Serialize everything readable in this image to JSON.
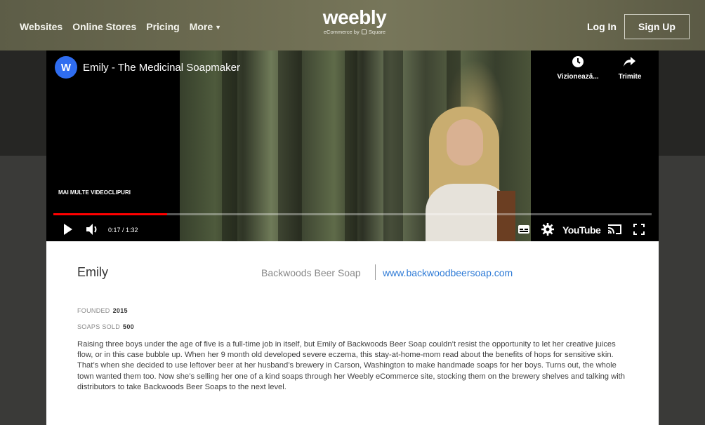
{
  "header": {
    "nav": [
      "Websites",
      "Online Stores",
      "Pricing",
      "More"
    ],
    "brand": "weebly",
    "brand_sub_left": "eCommerce by",
    "brand_sub_right": "Square",
    "login": "Log In",
    "signup": "Sign Up"
  },
  "video": {
    "channel_initial": "W",
    "title": "Emily - The Medicinal Soapmaker",
    "watch_later": "Vizionează...",
    "share": "Trimite",
    "more_videos": "MAI MULTE VIDEOCLIPURI",
    "time": "0:17 / 1:32",
    "progress": 0.19,
    "youtube_label": "YouTube",
    "icons": [
      "clock-icon",
      "share-icon",
      "play-icon",
      "volume-icon",
      "subtitles-icon",
      "settings-icon",
      "cast-icon",
      "fullscreen-icon"
    ],
    "progress_color": "#ff0000"
  },
  "profile": {
    "name": "Emily",
    "company": "Backwoods Beer Soap",
    "website": "www.backwoodbeersoap.com",
    "founded_label": "FOUNDED",
    "founded": "2015",
    "soaps_label": "SOAPS SOLD",
    "soaps": "500",
    "description": "Raising three boys under the age of five is a full-time job in itself, but Emily of Backwoods Beer Soap couldn’t resist the opportunity to let her creative juices flow, or in this case bubble up. When her 9 month old developed severe eczema, this stay-at-home-mom read about the benefits of hops for sensitive skin. That’s when she decided to use leftover beer at her husband’s brewery in Carson, Washington to make handmade soaps for her boys. Turns out, the whole town wanted them too. Now she’s selling her one of a kind soaps through her Weebly eCommerce site, stocking them on the brewery shelves and talking with distributors to take Backwoods Beer Soaps to the next level."
  },
  "colors": {
    "header": "#6b6a50",
    "link": "#2d7ad6",
    "channel": "#2f6df0"
  }
}
